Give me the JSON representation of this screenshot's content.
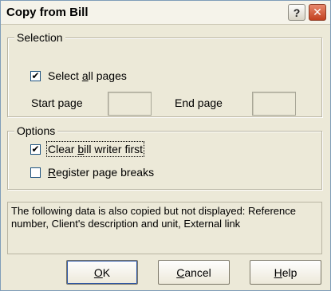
{
  "window": {
    "title": "Copy from Bill"
  },
  "titlebar": {
    "help_glyph": "?",
    "close_glyph": "✕"
  },
  "selection": {
    "legend": "Selection",
    "select_all": {
      "label_pre": "Select ",
      "label_mnemonic": "a",
      "label_post": "ll pages",
      "checked": true
    },
    "start_page": {
      "label": "Start page",
      "value": ""
    },
    "end_page": {
      "label": "End page",
      "value": ""
    }
  },
  "options": {
    "legend": "Options",
    "clear_first": {
      "label_pre": "Clear ",
      "label_mnemonic": "b",
      "label_post": "ill writer first",
      "checked": true
    },
    "register_breaks": {
      "label_mnemonic": "R",
      "label_post": "egister page breaks",
      "checked": false
    }
  },
  "info": {
    "text": "The following data is also copied but not displayed: Reference number, Client's description and unit, External link"
  },
  "buttons": {
    "ok": {
      "mnemonic": "O",
      "rest": "K"
    },
    "cancel": {
      "mnemonic": "C",
      "rest": "ancel"
    },
    "help": {
      "mnemonic": "H",
      "rest": "elp"
    }
  },
  "check_glyph": "✔"
}
